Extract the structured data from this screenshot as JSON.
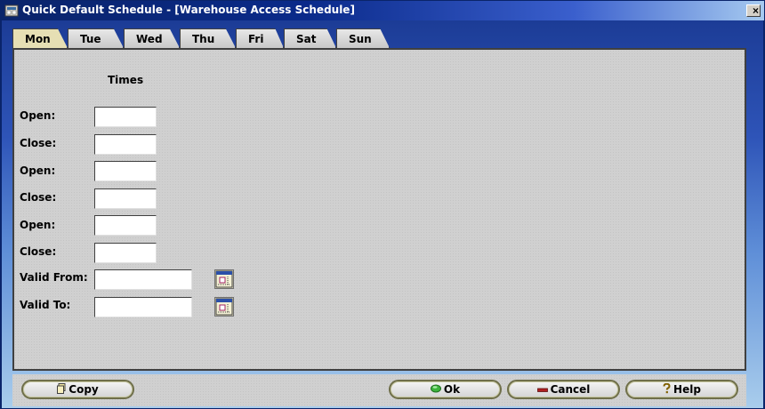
{
  "window": {
    "title": "Quick Default Schedule - [Warehouse Access Schedule]",
    "close_label": "×"
  },
  "tabs": [
    {
      "label": "Mon",
      "active": true
    },
    {
      "label": "Tue",
      "active": false
    },
    {
      "label": "Wed",
      "active": false
    },
    {
      "label": "Thu",
      "active": false
    },
    {
      "label": "Fri",
      "active": false
    },
    {
      "label": "Sat",
      "active": false
    },
    {
      "label": "Sun",
      "active": false
    }
  ],
  "panel": {
    "section_title": "Times",
    "rows": [
      {
        "label": "Open:",
        "value": ""
      },
      {
        "label": "Close:",
        "value": ""
      },
      {
        "label": "Open:",
        "value": ""
      },
      {
        "label": "Close:",
        "value": ""
      },
      {
        "label": "Open:",
        "value": ""
      },
      {
        "label": "Close:",
        "value": ""
      }
    ],
    "valid_from": {
      "label": "Valid From:",
      "value": ""
    },
    "valid_to": {
      "label": "Valid To:",
      "value": ""
    }
  },
  "buttons": {
    "copy": "Copy",
    "ok": "Ok",
    "cancel": "Cancel",
    "help": "Help"
  },
  "colors": {
    "titlebar": "#0a246a",
    "active_tab": "#e6dfb4",
    "panel": "#d0d0d0",
    "ok_icon": "#3cb43c",
    "cancel_icon": "#b02020"
  },
  "icons": {
    "app": "app-icon",
    "calendar": "calendar-icon",
    "copy": "copy-icon",
    "ok": "ok-icon",
    "cancel": "cancel-icon",
    "help": "help-icon"
  }
}
